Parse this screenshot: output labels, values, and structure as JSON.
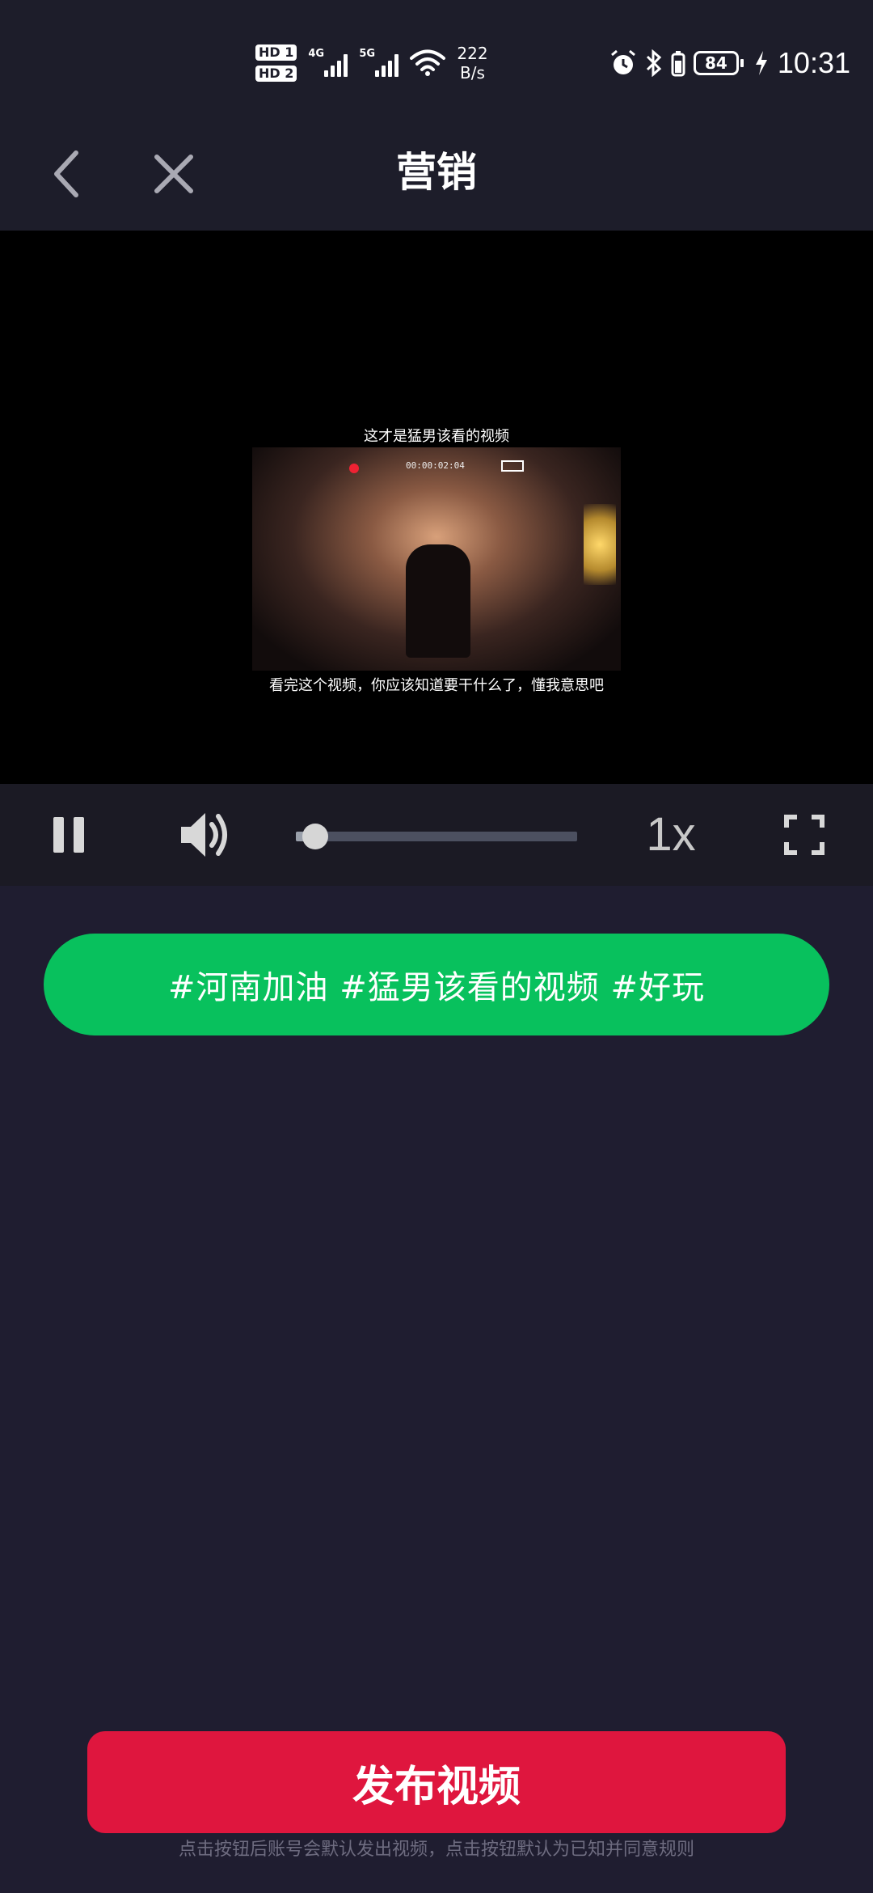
{
  "status_bar": {
    "sim1": "HD 1",
    "sim2": "HD 2",
    "net1": "4G",
    "net2": "5G",
    "speed_value": "222",
    "speed_unit": "B/s",
    "battery": "84",
    "time": "10:31"
  },
  "nav": {
    "title": "营销",
    "back_icon": "chevron-left-icon",
    "close_icon": "close-icon"
  },
  "video": {
    "title": "这才是猛男该看的视频",
    "timestamp": "00:00:02:04",
    "subtitle": "看完这个视频，你应该知道要干什么了，懂我意思吧"
  },
  "controls": {
    "pause_icon": "pause-icon",
    "volume_icon": "volume-icon",
    "progress": 0.07,
    "speed": "1x",
    "fullscreen_icon": "fullscreen-icon"
  },
  "tags": "#河南加油 #猛男该看的视频 #好玩",
  "publish": {
    "label": "发布视频",
    "disclaimer": "点击按钮后账号会默认发出视频，点击按钮默认为已知并同意规则"
  },
  "colors": {
    "background": "#1f1d30",
    "tag_green": "#08c15d",
    "publish_red": "#df163e"
  }
}
